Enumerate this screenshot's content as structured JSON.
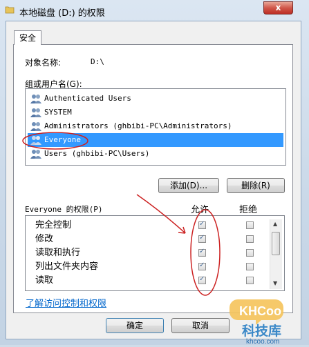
{
  "window": {
    "title": "本地磁盘 (D:) 的权限",
    "close_glyph": "x"
  },
  "tab": {
    "label": "安全"
  },
  "object": {
    "label": "对象名称:",
    "value": "D:\\"
  },
  "groups": {
    "label": "组或用户名(G):",
    "items": [
      {
        "name": "Authenticated Users"
      },
      {
        "name": "SYSTEM"
      },
      {
        "name": "Administrators (ghbibi-PC\\Administrators)"
      },
      {
        "name": "Everyone",
        "selected": true
      },
      {
        "name": "Users (ghbibi-PC\\Users)"
      }
    ]
  },
  "buttons": {
    "add": "添加(D)...",
    "remove": "删除(R)",
    "ok": "确定",
    "cancel": "取消"
  },
  "permissions": {
    "header": "Everyone 的权限(P)",
    "allow_label": "允许",
    "deny_label": "拒绝",
    "rows": [
      {
        "name": "完全控制",
        "allow": true,
        "deny": false
      },
      {
        "name": "修改",
        "allow": true,
        "deny": false
      },
      {
        "name": "读取和执行",
        "allow": true,
        "deny": false
      },
      {
        "name": "列出文件夹内容",
        "allow": true,
        "deny": false
      },
      {
        "name": "读取",
        "allow": true,
        "deny": false
      }
    ]
  },
  "link": {
    "text": "了解访问控制和权限"
  },
  "watermark": {
    "logo": "KHCoo",
    "cn": "科技库",
    "url": "khcoo.com"
  },
  "colors": {
    "selection": "#3399ff",
    "annotation": "#cc2222",
    "link": "#0066cc"
  }
}
